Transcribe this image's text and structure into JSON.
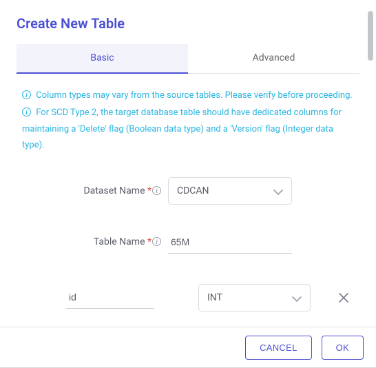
{
  "title": "Create New Table",
  "tabs": {
    "basic": "Basic",
    "advanced": "Advanced"
  },
  "notices": {
    "n1": "Column types may vary from the source tables. Please verify before proceeding.",
    "n2": "For SCD Type 2, the target database table should have dedicated columns for maintaining a 'Delete' flag (Boolean data type) and a 'Version' flag (Integer data type)."
  },
  "form": {
    "dataset_label": "Dataset Name ",
    "dataset_value": "CDCAN",
    "table_label": "Table Name ",
    "table_value": "65M"
  },
  "column": {
    "name": "id",
    "type": "INT"
  },
  "buttons": {
    "cancel": "CANCEL",
    "ok": "OK"
  }
}
